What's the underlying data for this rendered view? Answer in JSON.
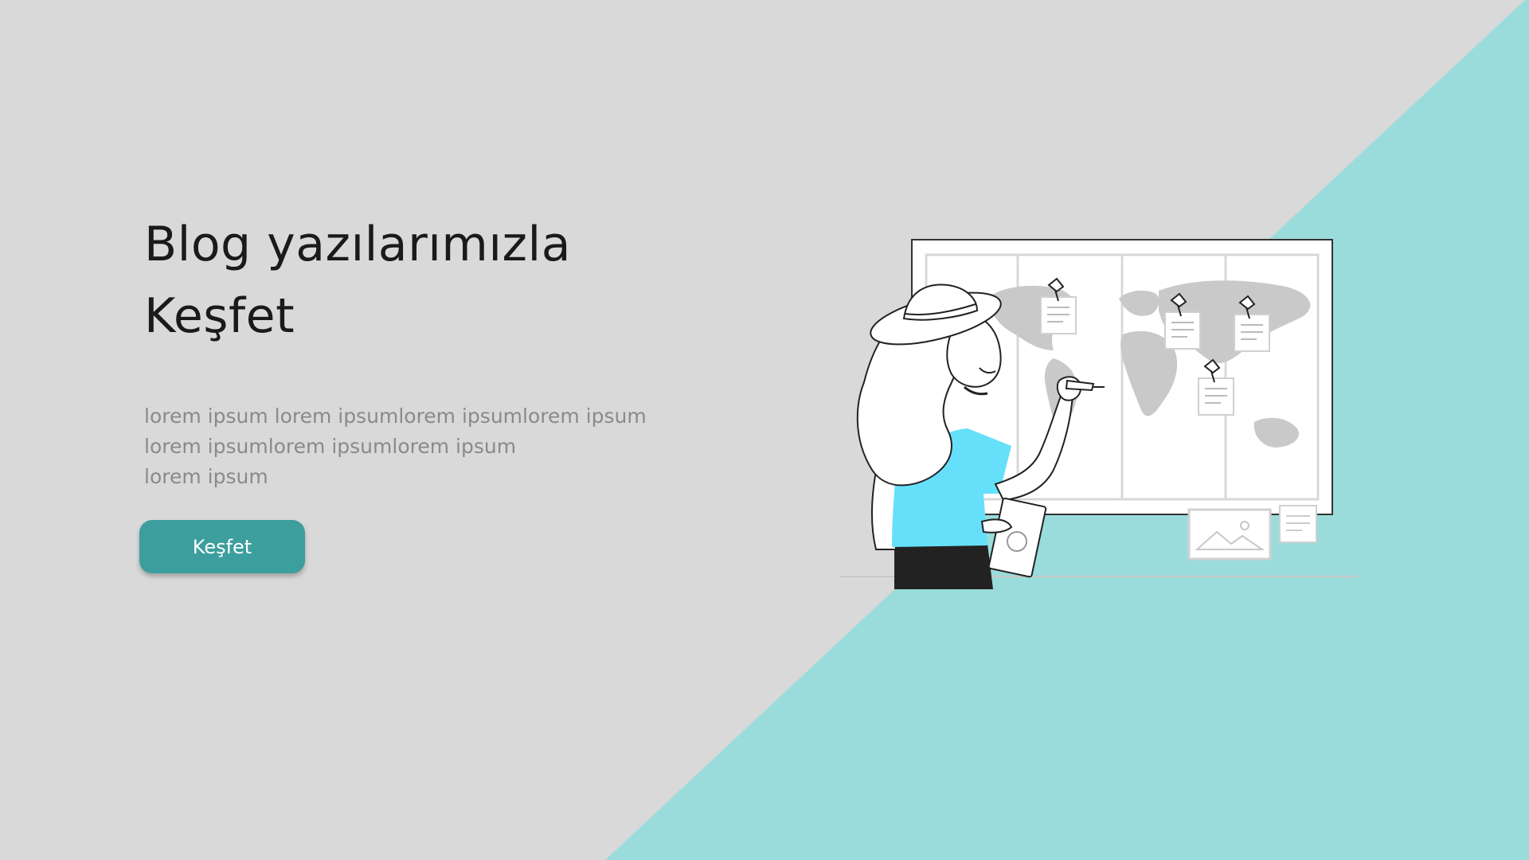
{
  "colors": {
    "background": "#d9d9d9",
    "accent_triangle": "#9adcdb",
    "button": "#3d9e9e",
    "shirt": "#66e0fa"
  },
  "hero": {
    "title_lines": [
      "Blog yazılarımızla",
      "Keşfet"
    ],
    "description_lines": [
      "lorem ipsum lorem ipsumlorem ipsumlorem ipsum",
      "lorem ipsumlorem ipsumlorem ipsum",
      "lorem ipsum"
    ],
    "button_label": "Keşfet"
  },
  "illustration": {
    "icon": "traveler-with-world-map-illustration"
  }
}
